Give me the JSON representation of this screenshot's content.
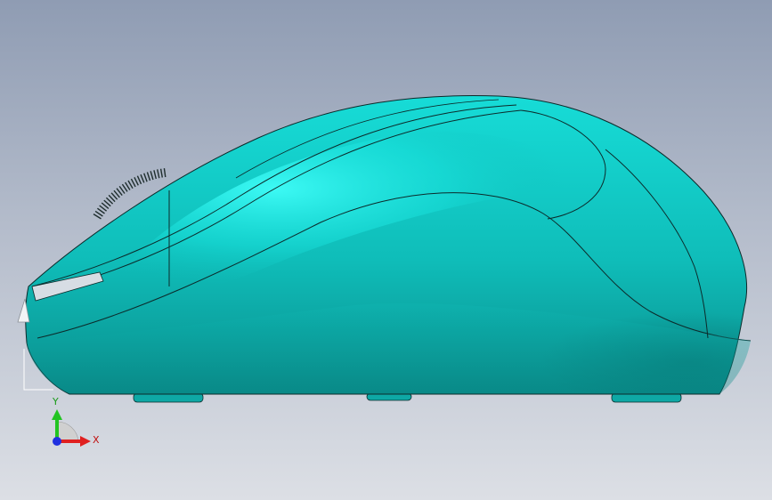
{
  "viewport": {
    "background_top": "#8f9cb3",
    "background_bottom": "#dcdfe5"
  },
  "model": {
    "body_color": "#10c9c4",
    "body_highlight": "#2ff3ee",
    "body_shadow": "#0a8f8d",
    "edge_color": "#0c2a2a",
    "scroll_wheel_color": "#1f2e2e",
    "view": "side"
  },
  "triad": {
    "y_label": "Y",
    "x_label": "X",
    "y_color": "#22c422",
    "x_color": "#e02020",
    "z_color": "#2030e0"
  }
}
